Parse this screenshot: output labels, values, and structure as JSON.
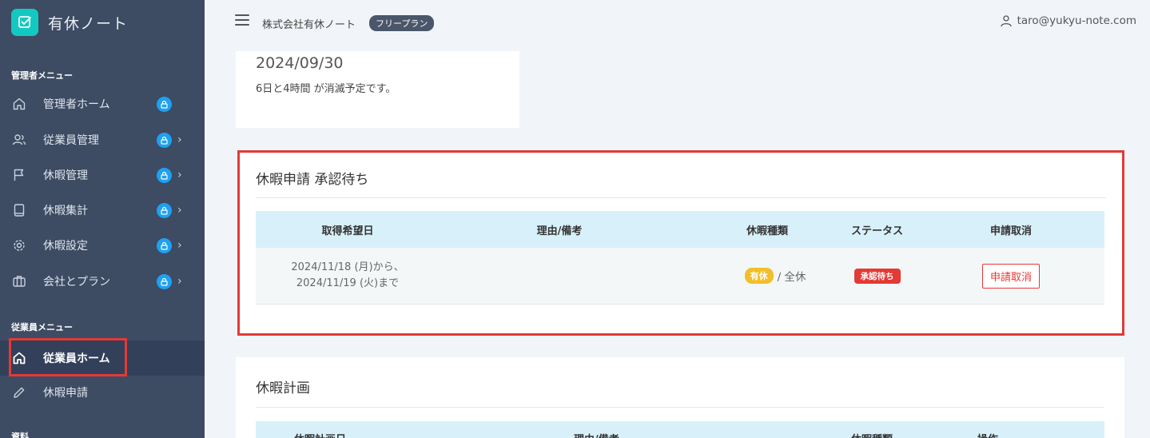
{
  "sidebar": {
    "brand": "有休ノート",
    "admin_section": "管理者メニュー",
    "admin_items": [
      {
        "label": "管理者ホーム"
      },
      {
        "label": "従業員管理"
      },
      {
        "label": "休暇管理"
      },
      {
        "label": "休暇集計"
      },
      {
        "label": "休暇設定"
      },
      {
        "label": "会社とプラン"
      }
    ],
    "employee_section": "従業員メニュー",
    "employee_items": [
      {
        "label": "従業員ホーム"
      },
      {
        "label": "休暇申請"
      }
    ],
    "other_section": "資料"
  },
  "header": {
    "company": "株式会社有休ノート",
    "plan": "フリープラン",
    "user_email": "taro@yukyu-note.com"
  },
  "expire_card": {
    "date": "2024/09/30",
    "text": "6日と4時間 が消滅予定です。"
  },
  "pending": {
    "title": "休暇申請 承認待ち",
    "columns": [
      "取得希望日",
      "理由/備考",
      "休暇種類",
      "ステータス",
      "申請取消"
    ],
    "rows": [
      {
        "date_from": "2024/11/18 (月)から、",
        "date_to": "2024/11/19 (火)まで",
        "reason": "",
        "type_badge": "有休",
        "type_text": "/ 全休",
        "status": "承認待ち",
        "cancel_label": "申請取消"
      }
    ]
  },
  "plan_card": {
    "title": "休暇計画",
    "columns": [
      "休暇計画日",
      "理由/備考",
      "休暇種類",
      "操作"
    ]
  },
  "colors": {
    "sidebar_bg": "#3d4b63",
    "accent": "#14c8c2",
    "danger": "#e53935",
    "info": "#1ea1f2",
    "warning": "#f2bf2a",
    "table_head": "#d8f0f9"
  }
}
